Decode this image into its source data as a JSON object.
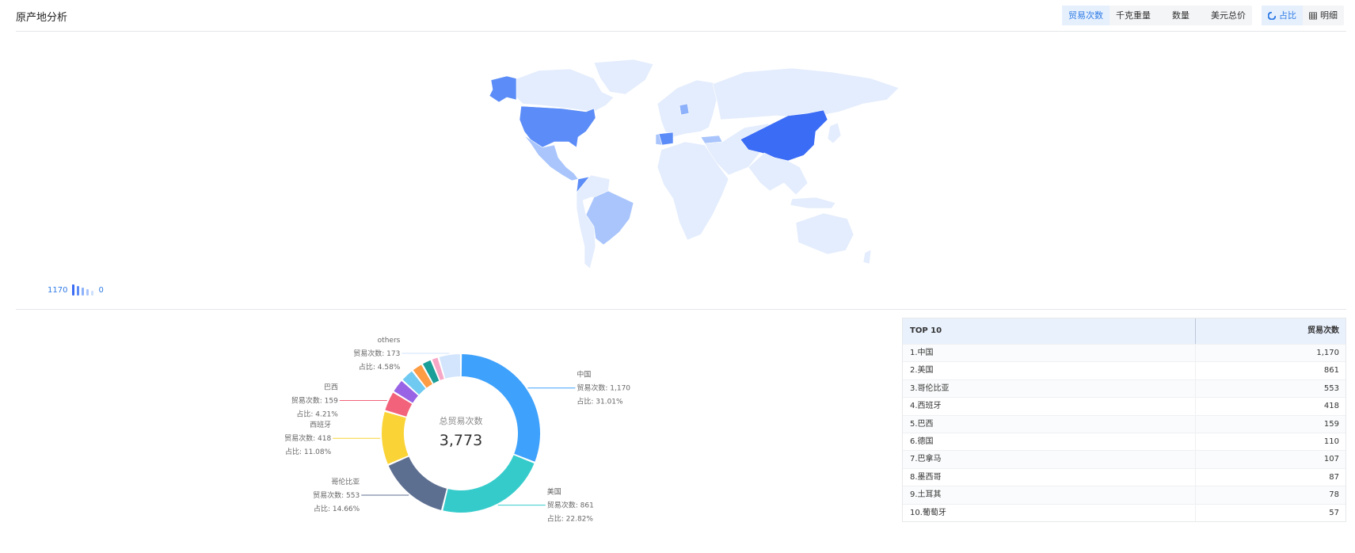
{
  "header": {
    "title": "原产地分析",
    "metric_tabs": [
      "贸易次数",
      "千克重量",
      "数量",
      "美元总价"
    ],
    "metric_active": 0,
    "view_tabs": [
      {
        "label": "占比",
        "icon": "pie-icon"
      },
      {
        "label": "明细",
        "icon": "table-icon"
      }
    ],
    "view_active": 0
  },
  "map": {
    "legend_max": "1170",
    "legend_min": "0",
    "colors": {
      "highest": "#3b6cf5",
      "high": "#5b8cf7",
      "mid": "#8db2fb",
      "low": "#a9c5fc",
      "base": "#e4edfd"
    }
  },
  "chart_data": {
    "type": "pie",
    "center_label": "总贸易次数",
    "center_value": "3,773",
    "slices": [
      {
        "name": "中国",
        "value": 1170,
        "value_text": "1,170",
        "percent": "31.01%",
        "color": "#3ea1fb"
      },
      {
        "name": "美国",
        "value": 861,
        "value_text": "861",
        "percent": "22.82%",
        "color": "#36cbcb"
      },
      {
        "name": "哥伦比亚",
        "value": 553,
        "value_text": "553",
        "percent": "14.66%",
        "color": "#5d6f91"
      },
      {
        "name": "西班牙",
        "value": 418,
        "value_text": "418",
        "percent": "11.08%",
        "color": "#fad336"
      },
      {
        "name": "巴西",
        "value": 159,
        "value_text": "159",
        "percent": "4.21%",
        "color": "#f2637b"
      },
      {
        "name": "德国",
        "value": 110,
        "value_text": "",
        "percent": "",
        "color": "#9863e5"
      },
      {
        "name": "巴拿马",
        "value": 107,
        "value_text": "",
        "percent": "",
        "color": "#70c9f0"
      },
      {
        "name": "墨西哥",
        "value": 87,
        "value_text": "",
        "percent": "",
        "color": "#fd9c43"
      },
      {
        "name": "土耳其",
        "value": 78,
        "value_text": "",
        "percent": "",
        "color": "#1a9e98"
      },
      {
        "name": "葡萄牙",
        "value": 57,
        "value_text": "",
        "percent": "",
        "color": "#f7a7c6"
      },
      {
        "name": "others",
        "value": 173,
        "value_text": "173",
        "percent": "4.58%",
        "color": "#d2e5fc"
      }
    ],
    "label_metric": "贸易次数",
    "label_percent": "占比"
  },
  "table": {
    "headers": [
      "TOP 10",
      "贸易次数"
    ],
    "rows": [
      {
        "name": "1.中国",
        "value": "1,170"
      },
      {
        "name": "2.美国",
        "value": "861"
      },
      {
        "name": "3.哥伦比亚",
        "value": "553"
      },
      {
        "name": "4.西班牙",
        "value": "418"
      },
      {
        "name": "5.巴西",
        "value": "159"
      },
      {
        "name": "6.德国",
        "value": "110"
      },
      {
        "name": "7.巴拿马",
        "value": "107"
      },
      {
        "name": "8.墨西哥",
        "value": "87"
      },
      {
        "name": "9.土耳其",
        "value": "78"
      },
      {
        "name": "10.葡萄牙",
        "value": "57"
      }
    ]
  }
}
